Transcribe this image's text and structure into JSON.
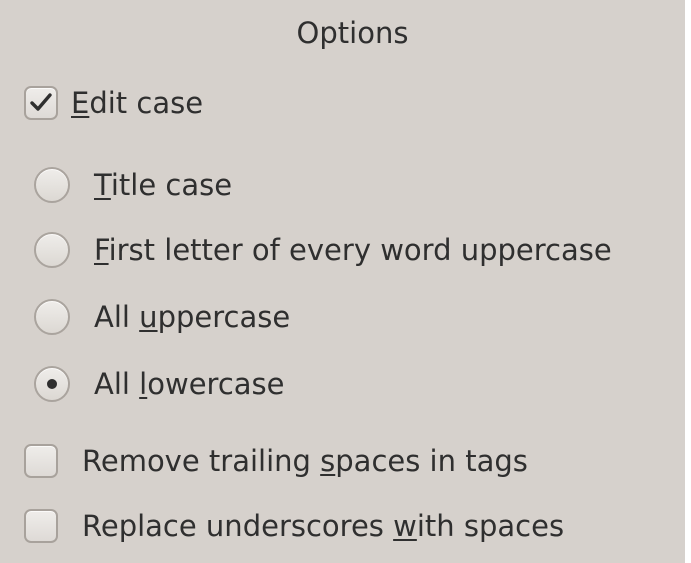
{
  "group_title": "Options",
  "edit_case": {
    "label_pre": "",
    "mnemonic": "E",
    "label_post": "dit case",
    "checked": true
  },
  "case_options": [
    {
      "pre": "",
      "mnemonic": "T",
      "post": "itle case",
      "selected": false
    },
    {
      "pre": "",
      "mnemonic": "F",
      "post": "irst letter of every word uppercase",
      "selected": false
    },
    {
      "pre": "All ",
      "mnemonic": "u",
      "post": "ppercase",
      "selected": false
    },
    {
      "pre": "All ",
      "mnemonic": "l",
      "post": "owercase",
      "selected": true
    }
  ],
  "remove_trailing": {
    "pre": "Remove trailing ",
    "mnemonic": "s",
    "post": "paces in tags",
    "checked": false
  },
  "replace_underscores": {
    "pre": "Replace underscores ",
    "mnemonic": "w",
    "post": "ith spaces",
    "checked": false
  },
  "icons": {
    "check": "check-mark-icon",
    "radio_dot": "radio-dot-icon"
  }
}
